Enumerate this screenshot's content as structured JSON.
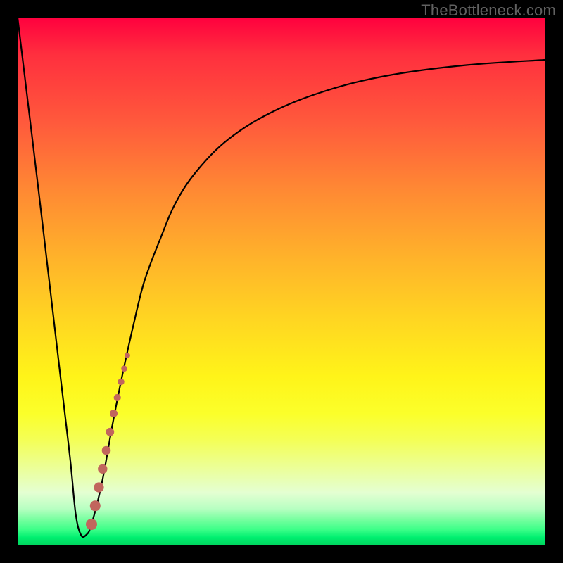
{
  "watermark": "TheBottleneck.com",
  "colors": {
    "curve": "#000000",
    "dots": "#c1665d",
    "background_top": "#ff003e",
    "background_bottom": "#00d45d",
    "frame": "#000000"
  },
  "chart_data": {
    "type": "line",
    "title": "",
    "xlabel": "",
    "ylabel": "",
    "xlim": [
      0,
      100
    ],
    "ylim": [
      0,
      100
    ],
    "grid": false,
    "series": [
      {
        "name": "bottleneck-curve",
        "x": [
          0,
          4,
          8,
          10,
          11,
          12,
          13,
          14,
          16,
          18,
          20,
          22,
          24,
          27,
          30,
          34,
          40,
          48,
          58,
          70,
          85,
          100
        ],
        "y": [
          100,
          67,
          33,
          16,
          6,
          2,
          2,
          4,
          12,
          23,
          33,
          42,
          50,
          58,
          65,
          71,
          77,
          82,
          86,
          89,
          91,
          92
        ]
      }
    ],
    "markers": {
      "name": "highlight-dots",
      "x": [
        14.0,
        14.7,
        15.4,
        16.1,
        16.8,
        17.5,
        18.2,
        18.9,
        19.6,
        20.2,
        20.8
      ],
      "y": [
        4.0,
        7.5,
        11.0,
        14.5,
        18.0,
        21.5,
        25.0,
        28.0,
        31.0,
        33.5,
        36.0
      ],
      "r": [
        7.5,
        7.0,
        6.6,
        6.2,
        5.8,
        5.4,
        5.0,
        4.6,
        4.2,
        3.8,
        3.4
      ]
    }
  }
}
